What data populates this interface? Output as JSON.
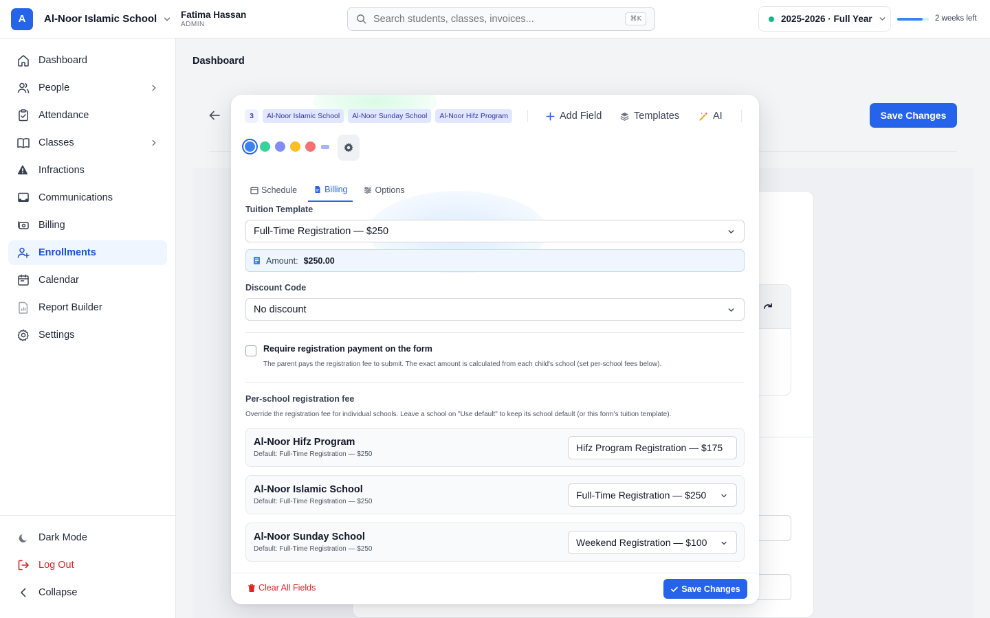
{
  "app": {
    "logo_letter": "A",
    "school_name": "Al-Noor Islamic School",
    "user_name": "Fatima Hassan",
    "user_role": "ADMIN"
  },
  "search": {
    "placeholder": "Search students, classes, invoices...",
    "shortcut": "⌘K"
  },
  "year": {
    "label": "2025-2026 · Full Year",
    "status_color": "#10b981",
    "progress_fraction": 0.8,
    "remaining": "2 weeks left"
  },
  "sidebar": {
    "items": [
      {
        "label": "Dashboard",
        "icon": "home-icon"
      },
      {
        "label": "People",
        "icon": "users-icon",
        "expandable": true
      },
      {
        "label": "Attendance",
        "icon": "clipboard-check-icon"
      },
      {
        "label": "Classes",
        "icon": "book-open-icon",
        "expandable": true
      },
      {
        "label": "Infractions",
        "icon": "warning-icon"
      },
      {
        "label": "Communications",
        "icon": "inbox-icon"
      },
      {
        "label": "Billing",
        "icon": "banknote-icon"
      },
      {
        "label": "Enrollments",
        "icon": "user-plus-icon",
        "active": true
      },
      {
        "label": "Calendar",
        "icon": "calendar-icon"
      },
      {
        "label": "Report Builder",
        "icon": "file-chart-icon"
      },
      {
        "label": "Settings",
        "icon": "gear-icon"
      }
    ],
    "bottom": {
      "dark_mode": "Dark Mode",
      "log_out": "Log Out",
      "collapse": "Collapse"
    }
  },
  "main": {
    "page_title": "Dashboard",
    "save_label": "Save Changes"
  },
  "panel": {
    "selected_count": "3",
    "schools": [
      "Al-Noor Islamic School",
      "Al-Noor Sunday School",
      "Al-Noor Hifz Program"
    ],
    "tools": {
      "add_field": "Add Field",
      "templates": "Templates",
      "ai": "AI"
    },
    "colors": [
      "#3b82f6",
      "#34d399",
      "#818cf8",
      "#fbbf24",
      "#f87171"
    ],
    "tabs": {
      "schedule": "Schedule",
      "billing": "Billing",
      "options": "Options"
    },
    "tuition_label": "Tuition Template",
    "tuition_value": "Full-Time Registration — $250",
    "amount_label": "Amount:",
    "amount_value": "$250.00",
    "discount_label": "Discount Code",
    "discount_value": "No discount",
    "require_title": "Require registration payment on the form",
    "require_desc": "The parent pays the registration fee to submit. The exact amount is calculated from each child's school (set per-school fees below).",
    "per_school_title": "Per-school registration fee",
    "per_school_desc": "Override the registration fee for individual schools. Leave a school on \"Use default\" to keep its school default (or this form's tuition template).",
    "school_fees": [
      {
        "name": "Al-Noor Hifz Program",
        "default": "Default: Full-Time Registration — $250",
        "value": "Hifz Program Registration — $175"
      },
      {
        "name": "Al-Noor Islamic School",
        "default": "Default: Full-Time Registration — $250",
        "value": "Full-Time Registration — $250"
      },
      {
        "name": "Al-Noor Sunday School",
        "default": "Default: Full-Time Registration — $250",
        "value": "Weekend Registration — $100"
      }
    ],
    "clear_label": "Clear All Fields",
    "save_label": "Save Changes"
  }
}
